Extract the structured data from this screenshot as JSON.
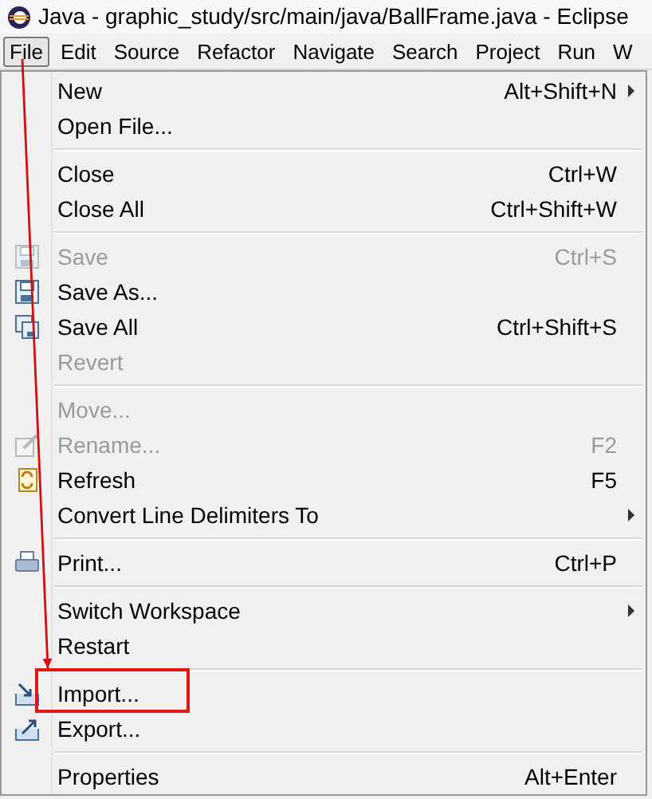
{
  "window": {
    "title": "Java - graphic_study/src/main/java/BallFrame.java - Eclipse"
  },
  "menu_bar": [
    {
      "label": "File",
      "selected": true
    },
    {
      "label": "Edit",
      "selected": false
    },
    {
      "label": "Source",
      "selected": false
    },
    {
      "label": "Refactor",
      "selected": false
    },
    {
      "label": "Navigate",
      "selected": false
    },
    {
      "label": "Search",
      "selected": false
    },
    {
      "label": "Project",
      "selected": false
    },
    {
      "label": "Run",
      "selected": false
    },
    {
      "label": "W",
      "selected": false
    }
  ],
  "file_menu": [
    {
      "kind": "item",
      "label": "New",
      "shortcut": "Alt+Shift+N",
      "submenu": true,
      "disabled": false
    },
    {
      "kind": "item",
      "label": "Open File...",
      "submenu": false,
      "disabled": false
    },
    {
      "kind": "separator"
    },
    {
      "kind": "item",
      "label": "Close",
      "shortcut": "Ctrl+W",
      "submenu": false,
      "disabled": false
    },
    {
      "kind": "item",
      "label": "Close All",
      "shortcut": "Ctrl+Shift+W",
      "submenu": false,
      "disabled": false
    },
    {
      "kind": "separator"
    },
    {
      "kind": "item",
      "label": "Save",
      "shortcut": "Ctrl+S",
      "submenu": false,
      "disabled": true
    },
    {
      "kind": "item",
      "label": "Save As...",
      "submenu": false,
      "disabled": false
    },
    {
      "kind": "item",
      "label": "Save All",
      "shortcut": "Ctrl+Shift+S",
      "submenu": false,
      "disabled": false
    },
    {
      "kind": "item",
      "label": "Revert",
      "submenu": false,
      "disabled": true
    },
    {
      "kind": "separator"
    },
    {
      "kind": "item",
      "label": "Move...",
      "submenu": false,
      "disabled": true
    },
    {
      "kind": "item",
      "label": "Rename...",
      "shortcut": "F2",
      "submenu": false,
      "disabled": true
    },
    {
      "kind": "item",
      "label": "Refresh",
      "shortcut": "F5",
      "submenu": false,
      "disabled": false
    },
    {
      "kind": "item",
      "label": "Convert Line Delimiters To",
      "submenu": true,
      "disabled": false
    },
    {
      "kind": "separator"
    },
    {
      "kind": "item",
      "label": "Print...",
      "shortcut": "Ctrl+P",
      "submenu": false,
      "disabled": false
    },
    {
      "kind": "separator"
    },
    {
      "kind": "item",
      "label": "Switch Workspace",
      "submenu": true,
      "disabled": false
    },
    {
      "kind": "item",
      "label": "Restart",
      "submenu": false,
      "disabled": false
    },
    {
      "kind": "separator"
    },
    {
      "kind": "item",
      "label": "Import...",
      "submenu": false,
      "disabled": false
    },
    {
      "kind": "item",
      "label": "Export...",
      "submenu": false,
      "disabled": false
    },
    {
      "kind": "separator"
    },
    {
      "kind": "item",
      "label": "Properties",
      "shortcut": "Alt+Enter",
      "submenu": false,
      "disabled": false
    }
  ]
}
